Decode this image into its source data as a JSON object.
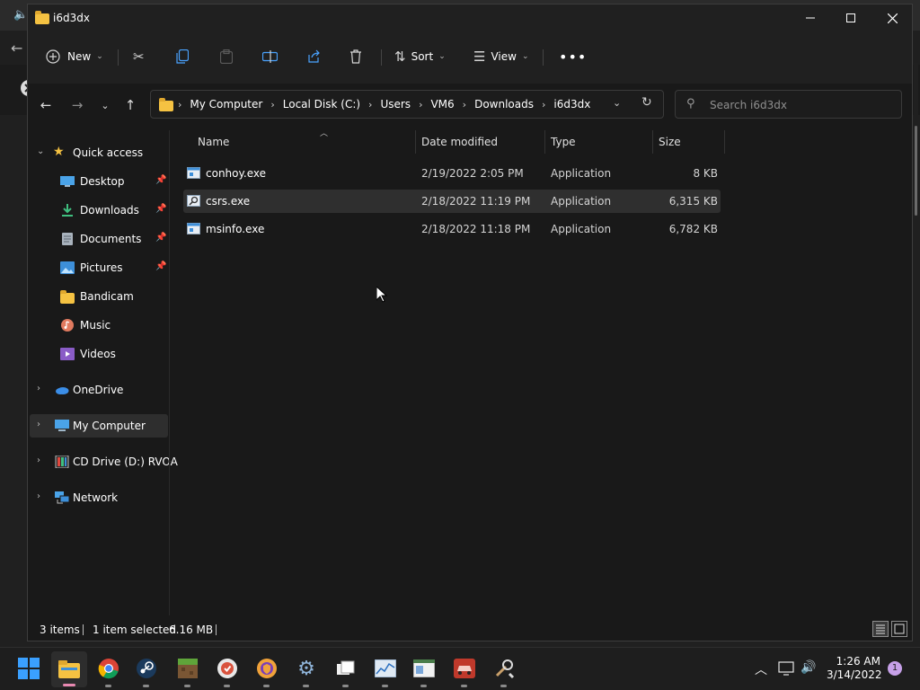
{
  "window": {
    "title": "i6d3dx"
  },
  "toolbar": {
    "new_label": "New",
    "sort_label": "Sort",
    "view_label": "View"
  },
  "address": {
    "crumbs": [
      "My Computer",
      "Local Disk (C:)",
      "Users",
      "VM6",
      "Downloads",
      "i6d3dx"
    ]
  },
  "search": {
    "placeholder": "Search i6d3dx"
  },
  "sidebar": {
    "quick_access": "Quick access",
    "items": [
      {
        "label": "Desktop",
        "pinned": true,
        "icon": "desktop-icon"
      },
      {
        "label": "Downloads",
        "pinned": true,
        "icon": "downloads-icon"
      },
      {
        "label": "Documents",
        "pinned": true,
        "icon": "documents-icon"
      },
      {
        "label": "Pictures",
        "pinned": true,
        "icon": "pictures-icon"
      },
      {
        "label": "Bandicam",
        "pinned": false,
        "icon": "folder-icon"
      },
      {
        "label": "Music",
        "pinned": false,
        "icon": "music-icon"
      },
      {
        "label": "Videos",
        "pinned": false,
        "icon": "videos-icon"
      }
    ],
    "onedrive": "OneDrive",
    "my_computer": "My Computer",
    "cd_drive": "CD Drive (D:) RVOA",
    "network": "Network"
  },
  "columns": {
    "name": "Name",
    "date": "Date modified",
    "type": "Type",
    "size": "Size"
  },
  "files": [
    {
      "name": "conhoy.exe",
      "date": "2/19/2022 2:05 PM",
      "type": "Application",
      "size": "8 KB",
      "selected": false
    },
    {
      "name": "csrs.exe",
      "date": "2/18/2022 11:19 PM",
      "type": "Application",
      "size": "6,315 KB",
      "selected": true
    },
    {
      "name": "msinfo.exe",
      "date": "2/18/2022 11:18 PM",
      "type": "Application",
      "size": "6,782 KB",
      "selected": false
    }
  ],
  "status": {
    "items": "3 items",
    "selected": "1 item selected",
    "size": "6.16 MB"
  },
  "clock": {
    "time": "1:26 AM",
    "date": "3/14/2022"
  },
  "notifications": {
    "count": "1"
  },
  "colors": {
    "background": "#191919",
    "selection": "#2f2f2f",
    "folder": "#f5c242",
    "accent": "#0078d4"
  }
}
